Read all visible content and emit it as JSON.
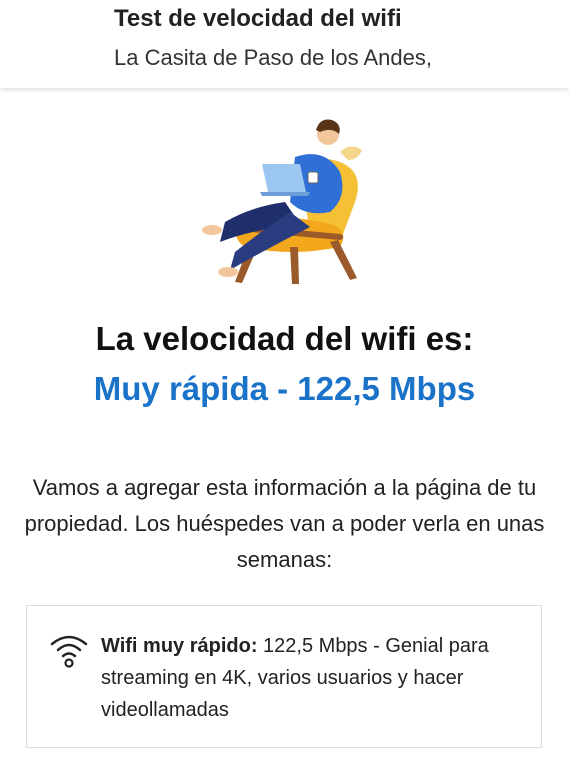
{
  "header": {
    "title": "Test de velocidad del wifi",
    "subtitle": "La Casita de Paso de los Andes,"
  },
  "result": {
    "heading": "La velocidad del wifi es:",
    "value": "Muy rápida - 122,5 Mbps",
    "value_color": "#1a73c8"
  },
  "info": {
    "text": "Vamos a agregar esta información a la página de tu propiedad. Los huéspedes van a poder verla en unas semanas:"
  },
  "card": {
    "icon": "wifi-icon",
    "label": "Wifi muy rápido:",
    "description": "122,5 Mbps - Genial para streaming en 4K, varios usuarios y hacer videollamadas"
  }
}
